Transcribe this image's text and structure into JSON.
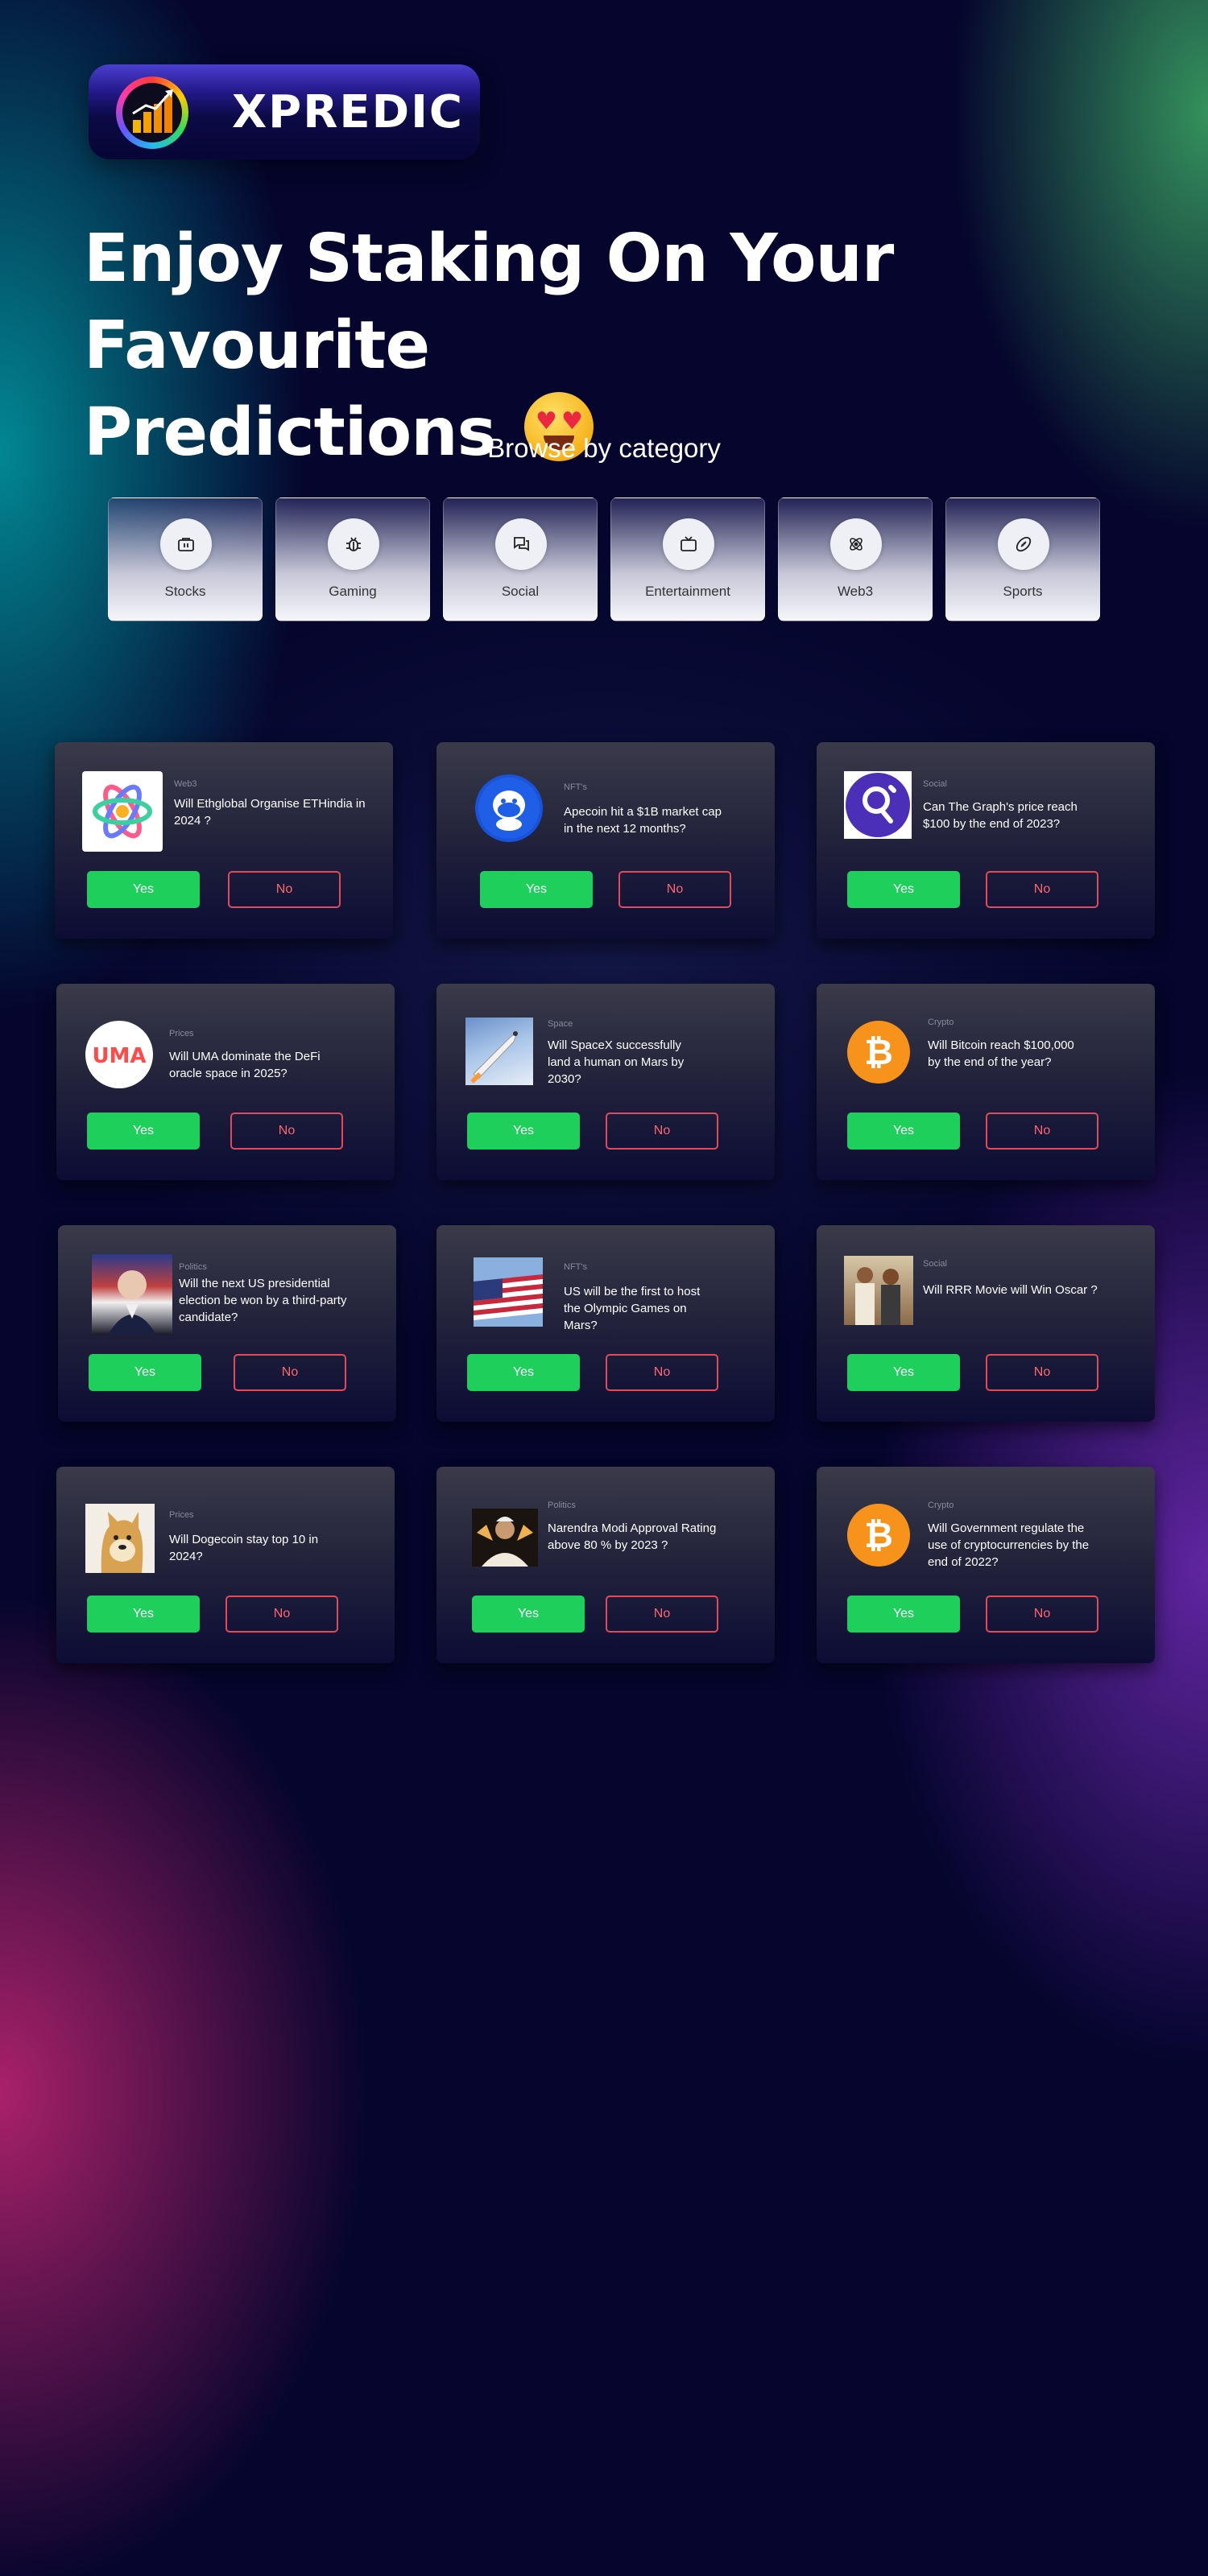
{
  "brand": {
    "name": "XPREDIC"
  },
  "hero": {
    "line1": "Enjoy Staking On Your Favourite",
    "line2": "Predictions"
  },
  "browse": {
    "title": "Browse by category",
    "categories": [
      {
        "label": "Stocks",
        "icon": "briefcase-icon"
      },
      {
        "label": "Gaming",
        "icon": "bug-icon"
      },
      {
        "label": "Social",
        "icon": "chat-icon"
      },
      {
        "label": "Entertainment",
        "icon": "tv-icon"
      },
      {
        "label": "Web3",
        "icon": "atom-icon"
      },
      {
        "label": "Sports",
        "icon": "football-icon"
      }
    ]
  },
  "markets": [
    {
      "category": "Web3",
      "question": "Will Ethglobal Organise ETHindia in 2024 ?",
      "image": "ethglobal-logo",
      "yes": "Yes",
      "no": "No"
    },
    {
      "category": "NFT's",
      "question": "Apecoin hit a $1B market cap in the next 12 months?",
      "image": "apecoin-logo",
      "yes": "Yes",
      "no": "No"
    },
    {
      "category": "Social",
      "question": "Can The Graph's price reach $100 by the end of 2023?",
      "image": "the-graph-logo",
      "yes": "Yes",
      "no": "No"
    },
    {
      "category": "Prices",
      "question": "Will UMA dominate the DeFi oracle space in 2025?",
      "image": "uma-logo",
      "yes": "Yes",
      "no": "No"
    },
    {
      "category": "Space",
      "question": "Will SpaceX successfully land a human on Mars by 2030?",
      "image": "spacex-rocket-photo",
      "yes": "Yes",
      "no": "No"
    },
    {
      "category": "Crypto",
      "question": "Will Bitcoin reach $100,000 by the end of the year?",
      "image": "bitcoin-logo",
      "yes": "Yes",
      "no": "No"
    },
    {
      "category": "Politics",
      "question": "Will the next US presidential election be won by a third-party candidate?",
      "image": "president-photo",
      "yes": "Yes",
      "no": "No"
    },
    {
      "category": "NFT's",
      "question": "US will be the first to host the Olympic Games on Mars?",
      "image": "us-flag-photo",
      "yes": "Yes",
      "no": "No"
    },
    {
      "category": "Social",
      "question": "Will RRR Movie will Win Oscar ?",
      "image": "rrr-movie-photo",
      "yes": "Yes",
      "no": "No"
    },
    {
      "category": "Prices",
      "question": "Will Dogecoin stay top 10 in 2024?",
      "image": "dogecoin-photo",
      "yes": "Yes",
      "no": "No"
    },
    {
      "category": "Politics",
      "question": "Narendra Modi Approval Rating above 80 % by 2023 ?",
      "image": "modi-photo",
      "yes": "Yes",
      "no": "No"
    },
    {
      "category": "Crypto",
      "question": "Will Government regulate the use of cryptocurrencies by the end of 2022?",
      "image": "bitcoin-logo",
      "yes": "Yes",
      "no": "No"
    }
  ],
  "colors": {
    "yes": "#1fcf5c",
    "no": "#e04a5a",
    "background": "#05052d",
    "bitcoin": "#f7931a"
  }
}
